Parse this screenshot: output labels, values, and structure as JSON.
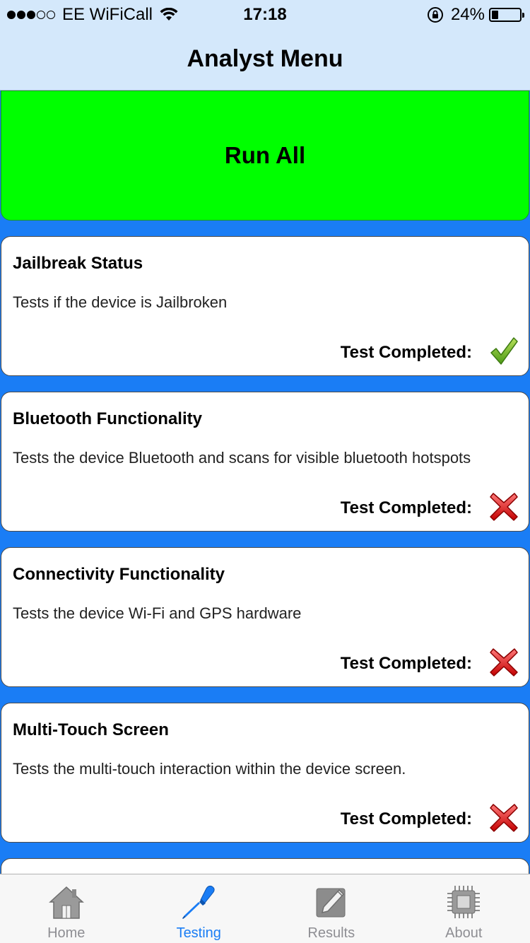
{
  "status_bar": {
    "carrier": "EE WiFiCall",
    "time": "17:18",
    "battery_percent": "24%",
    "battery_level": 0.24,
    "signal_bars": 3,
    "signal_total": 5
  },
  "nav": {
    "title": "Analyst Menu"
  },
  "run_all": {
    "label": "Run All",
    "color": "#00ff00"
  },
  "tests": [
    {
      "title": "Jailbreak Status",
      "description": "Tests if the device is Jailbroken",
      "completed_label": "Test Completed:",
      "status": "check-icon"
    },
    {
      "title": "Bluetooth Functionality",
      "description": "Tests the device Bluetooth and scans for visible bluetooth hotspots",
      "completed_label": "Test Completed:",
      "status": "cross-icon"
    },
    {
      "title": "Connectivity Functionality",
      "description": "Tests the device Wi-Fi and GPS hardware",
      "completed_label": "Test Completed:",
      "status": "cross-icon"
    },
    {
      "title": "Multi-Touch Screen",
      "description": "Tests the multi-touch interaction within the device screen.",
      "completed_label": "Test Completed:",
      "status": "cross-icon"
    }
  ],
  "tab_bar": {
    "items": [
      {
        "label": "Home",
        "icon": "home-icon"
      },
      {
        "label": "Testing",
        "icon": "screwdriver-icon",
        "active": true
      },
      {
        "label": "Results",
        "icon": "edit-icon"
      },
      {
        "label": "About",
        "icon": "chip-icon"
      }
    ]
  },
  "colors": {
    "accent": "#1a7df5",
    "background": "#1a7df5",
    "nav_bg": "#d4e8fb"
  }
}
